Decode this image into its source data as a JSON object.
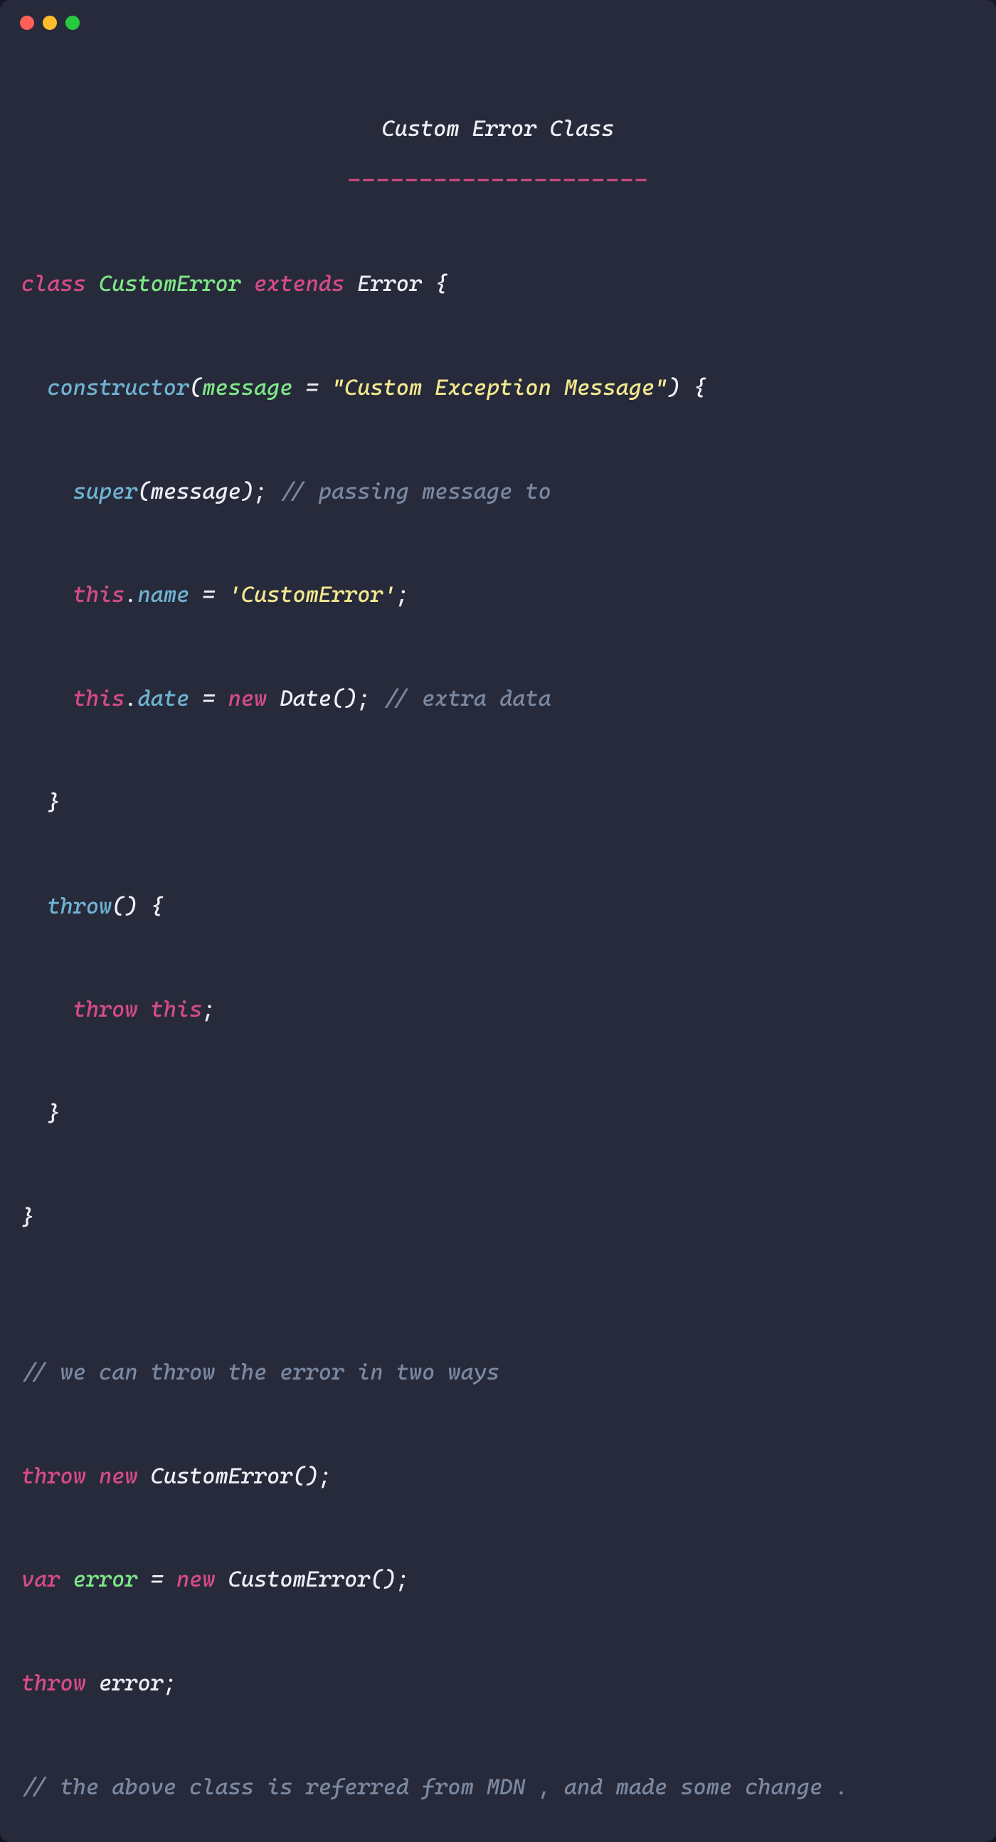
{
  "header": {
    "title": "Custom Error Class",
    "divider": "---------------------"
  },
  "code": {
    "kw_class": "class",
    "cls_name": "CustomError",
    "kw_extends": "extends",
    "base_cls": "Error",
    "brace_open": " {",
    "ctor": "constructor",
    "paren_open": "(",
    "param_msg": "message",
    "eq": " = ",
    "default_str": "\"Custom Exception Message\"",
    "paren_close_brace": ") {",
    "super_call": "super",
    "super_args_open": "(",
    "super_arg": "message",
    "super_args_close": ");",
    "cmt_passing": " // passing message to",
    "kw_this1": "this",
    "dot": ".",
    "prop_name": "name",
    "assign": " = ",
    "str_name": "'CustomError'",
    "semi": ";",
    "kw_this2": "this",
    "prop_date": "date",
    "kw_new": "new",
    "date_cls": "Date",
    "date_call": "();",
    "cmt_extra": " // extra data",
    "brace_close": "}",
    "method_throw": "throw",
    "method_open": "() {",
    "kw_throw": "throw",
    "kw_this3": "this",
    "cmt_twoways": "// we can throw the error in two ways",
    "throw_new": "throw",
    "new1": "new",
    "ctor_call1": "CustomError",
    "call1_end": "();",
    "kw_var": "var",
    "var_error": "error",
    "new2": "new",
    "ctor_call2": "CustomError",
    "call2_end": "();",
    "throw_err": "throw",
    "err_ident": "error",
    "cmt_mdn": "// the above class is referred from MDN , and made some change ."
  }
}
